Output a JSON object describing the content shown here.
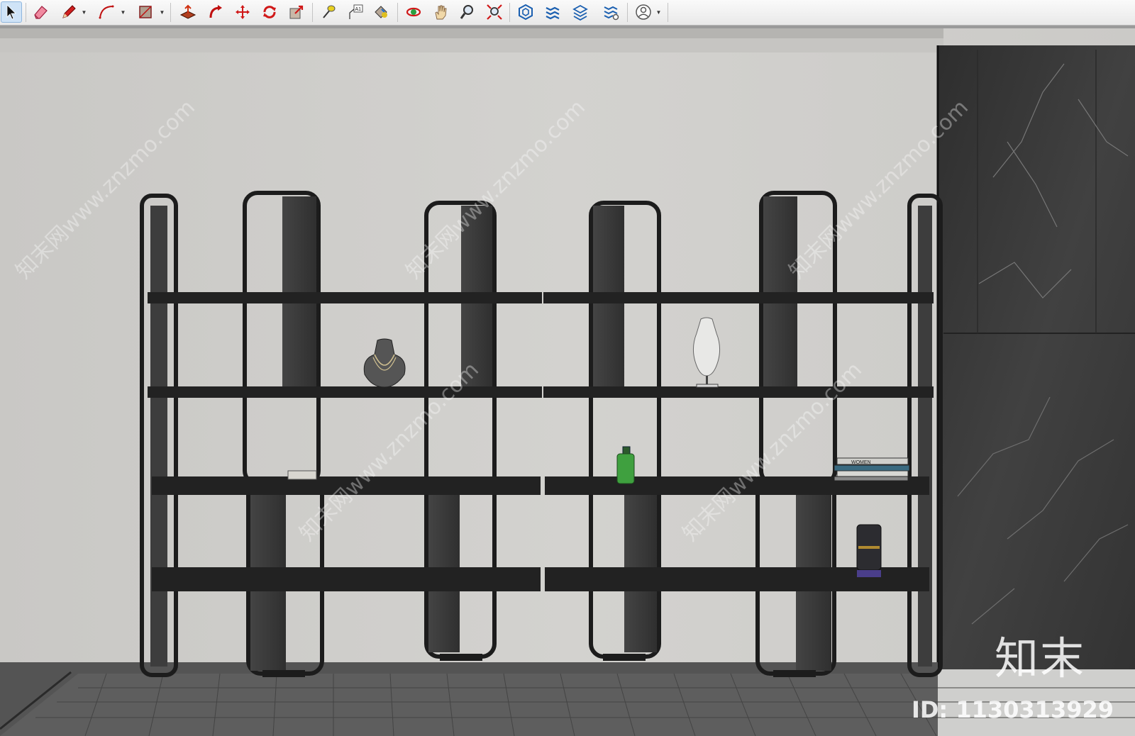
{
  "toolbar": {
    "tools": [
      {
        "icon": "select-arrow-icon",
        "active": true
      },
      {
        "icon": "eraser-icon"
      },
      {
        "icon": "pencil-line-icon",
        "has_menu": true
      },
      {
        "icon": "arc-icon",
        "has_menu": true
      },
      {
        "icon": "rectangle-icon",
        "has_menu": true
      },
      {
        "icon": "push-pull-icon"
      },
      {
        "icon": "follow-me-icon"
      },
      {
        "icon": "move-icon"
      },
      {
        "icon": "rotate-icon"
      },
      {
        "icon": "scale-icon"
      },
      {
        "icon": "tape-measure-icon"
      },
      {
        "icon": "text-label-icon",
        "label": "A1"
      },
      {
        "icon": "paint-bucket-icon"
      },
      {
        "icon": "orbit-icon"
      },
      {
        "icon": "pan-hand-icon"
      },
      {
        "icon": "zoom-icon"
      },
      {
        "icon": "zoom-extents-icon"
      },
      {
        "icon": "3d-warehouse-icon"
      },
      {
        "icon": "extension-warehouse-icon"
      },
      {
        "icon": "layout-send-icon"
      },
      {
        "icon": "extension-manager-icon"
      },
      {
        "icon": "account-icon",
        "has_menu": true
      }
    ]
  },
  "viewport": {
    "scene": "3D model of a black metal display shelving unit with wood panels in front of a plaster wall and marble column",
    "shelf_items": [
      {
        "icon": "necklace-bust-icon"
      },
      {
        "icon": "torso-mannequin-icon"
      },
      {
        "icon": "small-box-icon"
      },
      {
        "icon": "green-bottle-icon"
      },
      {
        "icon": "book-stack-icon",
        "spine_text": "WOMEN"
      },
      {
        "icon": "candle-jar-icon"
      }
    ],
    "watermark_brand": "知末",
    "watermark_id": "ID: 1130313929",
    "diagonal_watermark": "知末网www.znzmo.com"
  },
  "colors": {
    "wall": "#cfcfcd",
    "floor": "#4a4a4a",
    "frame": "#1c1c1c",
    "wood_panel": "#3c3c3c",
    "marble": "#3a3a3a",
    "selected_tool": "#cfe3f7"
  }
}
